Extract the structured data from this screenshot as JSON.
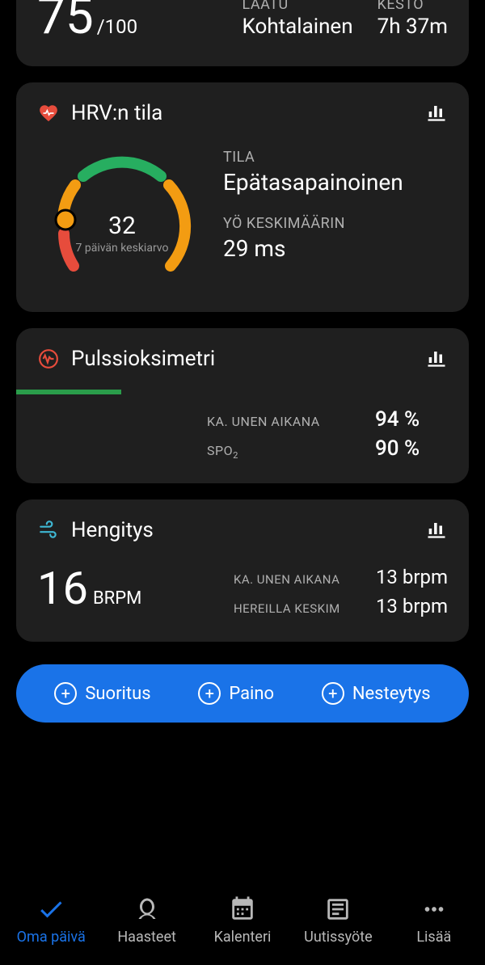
{
  "sleep": {
    "score": "75",
    "score_denom": "/100",
    "quality_label": "LAATU",
    "quality_value": "Kohtalainen",
    "duration_label": "KESTO",
    "duration_value": "7h 37m"
  },
  "hrv": {
    "title": "HRV:n tila",
    "gauge_value": "32",
    "gauge_sub": "7 päivän keskiarvo",
    "status_label": "TILA",
    "status_value": "Epätasapainoinen",
    "night_label": "YÖ KESKIMÄÄRIN",
    "night_value": "29 ms"
  },
  "pulseox": {
    "title": "Pulssioksimetri",
    "sleep_avg_label": "KA. UNEN AIKANA",
    "sleep_avg_value": "94 %",
    "spo2_label": "SPO",
    "spo2_sub": "2",
    "spo2_value": "90 %"
  },
  "breath": {
    "title": "Hengitys",
    "score": "16",
    "unit": "BRPM",
    "sleep_avg_label": "KA. UNEN AIKANA",
    "sleep_avg_value": "13 brpm",
    "awake_label": "HEREILLA KESKIM",
    "awake_value": "13 brpm"
  },
  "actions": {
    "activity": "Suoritus",
    "weight": "Paino",
    "hydration": "Nesteytys"
  },
  "nav": {
    "my_day": "Oma päivä",
    "challenges": "Haasteet",
    "calendar": "Kalenteri",
    "newsfeed": "Uutissyöte",
    "more": "Lisää"
  }
}
